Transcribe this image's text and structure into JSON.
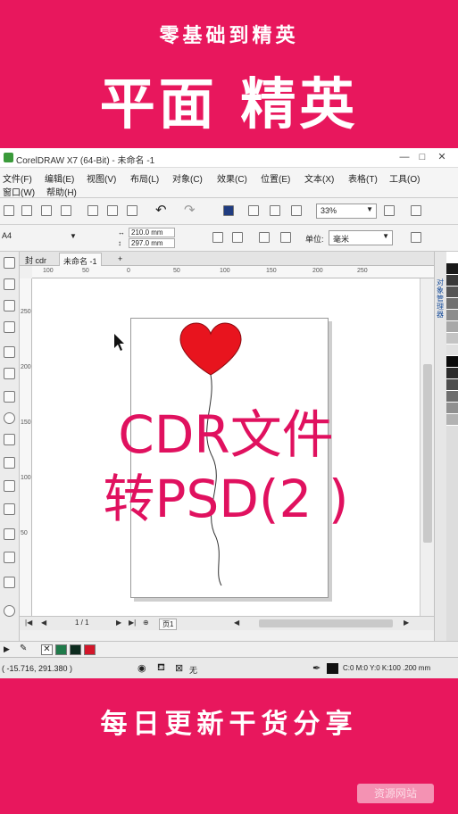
{
  "banner": {
    "subtitle": "零基础到精英",
    "title": "平面 精英",
    "bottom_text": "每日更新干货分享",
    "watermark": "资源网站"
  },
  "window": {
    "title": "CorelDRAW X7 (64-Bit) - 未命名 -1",
    "min_symbol": "—",
    "max_symbol": "□",
    "close_symbol": "✕"
  },
  "menu": {
    "row1": [
      "文件(F)",
      "编辑(E)",
      "视图(V)",
      "布局(L)",
      "对象(C)",
      "效果(C)",
      "位置(E)",
      "文本(X)",
      "表格(T)",
      "工具(O)"
    ],
    "row2": [
      "窗口(W)",
      "帮助(H)"
    ]
  },
  "toolbar": {
    "zoom": "33%",
    "page_size": "A4",
    "width": "210.0 mm",
    "height": "297.0 mm",
    "unit_label": "单位:",
    "unit_value": "毫米"
  },
  "tabs": {
    "welcome": "封 cdr",
    "document": "未命名 -1",
    "add": "+"
  },
  "ruler": {
    "h_ticks": [
      "100",
      "50",
      "0",
      "50",
      "100",
      "150",
      "200",
      "250"
    ],
    "v_ticks": [
      "250",
      "200",
      "150",
      "100",
      "50"
    ]
  },
  "canvas": {
    "overlay_line1": "CDR文件",
    "overlay_line2": "转PSD(2 )"
  },
  "docker": {
    "label": "对象管理器"
  },
  "pagenav": {
    "page_count": "1 / 1",
    "page_tab": "页1"
  },
  "status": {
    "coords": "( -15.716, 291.380 )",
    "fill_none": "无",
    "fill_info": "C:0 M:0 Y:0 K:100  .200 mm"
  },
  "colors": {
    "brand": "#e8175d",
    "overlay_text": "#e0115f",
    "balloon": "#e8141e"
  },
  "icons": {
    "balloon": "heart-balloon-icon",
    "cursor": "mouse-pointer-icon"
  }
}
